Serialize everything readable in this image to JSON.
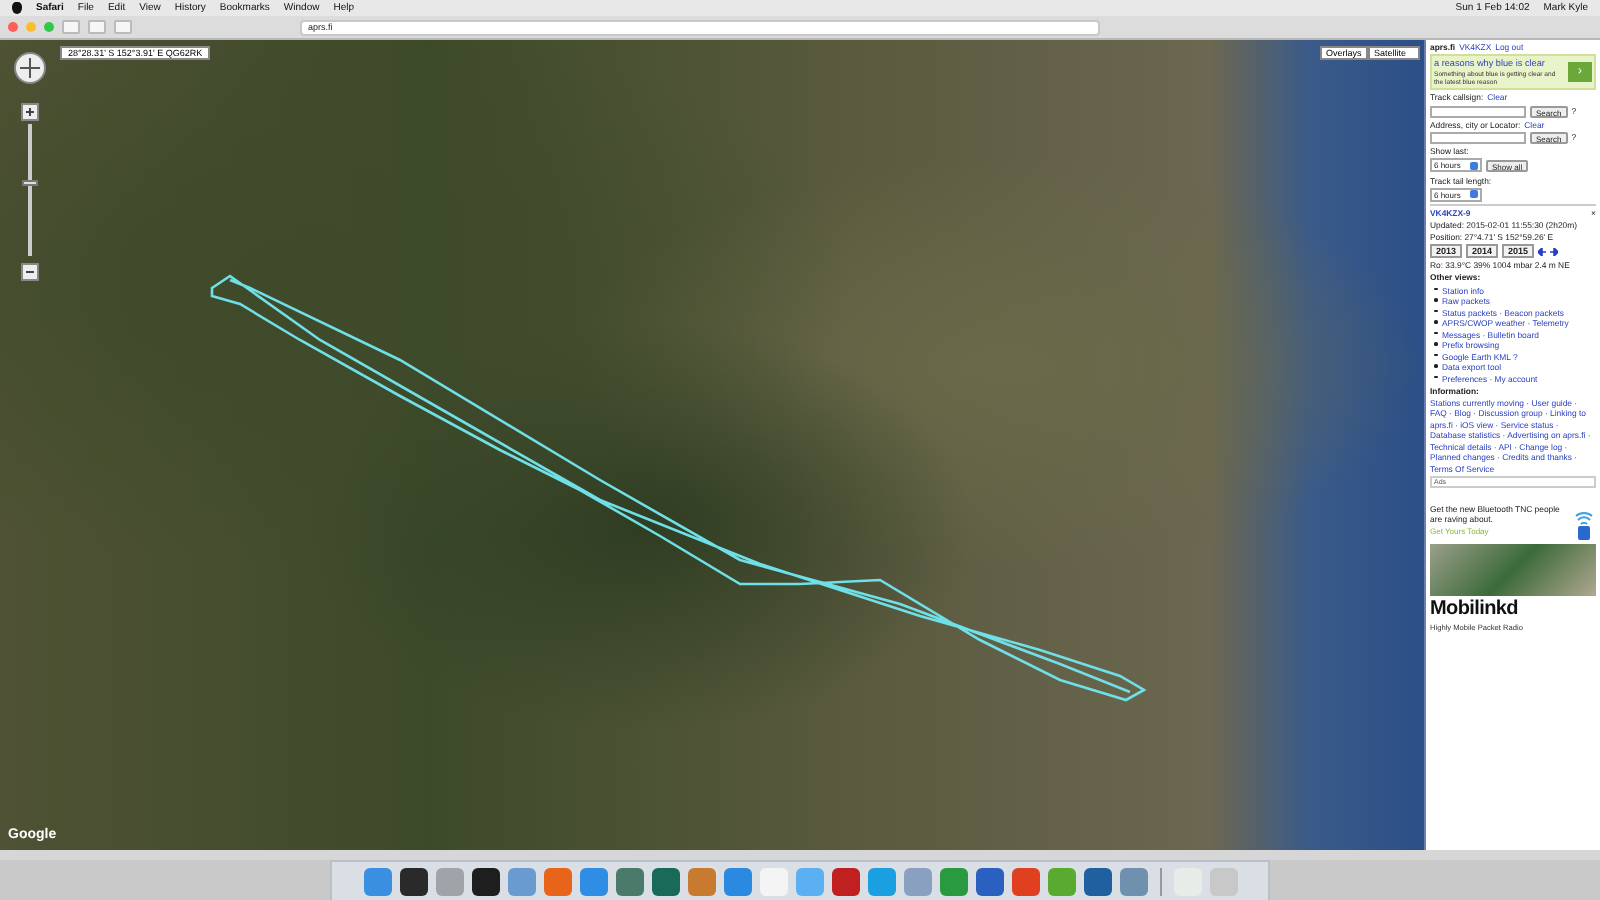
{
  "menu_bar": {
    "items": [
      "Safari",
      "File",
      "Edit",
      "View",
      "History",
      "Bookmarks",
      "Window",
      "Help"
    ],
    "clock": "Sun 1 Feb 14:02",
    "user": "Mark Kyle"
  },
  "toolbar": {
    "address": "aprs.fi"
  },
  "map": {
    "coordinates": "28°28.31' S 152°3.91' E QG62RK",
    "overlay_button": "Overlays",
    "map_type": "Satellite",
    "zoom_slider": {
      "level": 0.55
    },
    "logo": "Google"
  },
  "sidebar": {
    "header": {
      "site": "aprs.fi",
      "callsign": "VK4KZX",
      "logout": "Log out"
    },
    "top_ad": {
      "headline": "a reasons why blue is clear",
      "body": "Something about blue is getting clear and the latest blue reason",
      "button": "›"
    },
    "track_callsign": {
      "label": "Track callsign:",
      "clear": "Clear",
      "button": "Search",
      "help": "?"
    },
    "address_search": {
      "label": "Address, city or Locator:",
      "clear": "Clear",
      "button": "Search",
      "help": "?"
    },
    "show_last": {
      "label": "Show last:",
      "value": "6 hours",
      "button": "Show all"
    },
    "track_tail": {
      "label": "Track tail length:",
      "value": "6 hours"
    },
    "station": {
      "callsign": "VK4KZX-9",
      "close": "×",
      "updated": "Updated: 2015-02-01 11:55:30 (2h20m)",
      "position": "Position: 27°4.71' S 152°59.26' E"
    },
    "years": [
      "2013",
      "2014",
      "2015"
    ],
    "weather": "Ro: 33.9°C 39% 1004 mbar 2.4 m NE",
    "other_views": {
      "title": "Other views:",
      "links": [
        "Station info",
        "Raw packets",
        "Status packets · Beacon packets",
        "APRS/CWOP weather · Telemetry",
        "Messages · Bulletin board",
        "Prefix browsing",
        "Google Earth KML ?",
        "Data export tool",
        "Preferences · My account"
      ]
    },
    "information": {
      "title": "Information:",
      "text": "Stations currently moving · User guide · FAQ · Blog · Discussion group · Linking to aprs.fi · iOS view · Service status · Database statistics · Advertising on aprs.fi · Technical details · API · Change log · Planned changes · Credits and thanks · Terms Of Service"
    },
    "ads_label": "Ads",
    "bottom_ad": {
      "headline": "Get the new Bluetooth TNC people are raving about.",
      "cta": "Get Yours Today",
      "brand": "Mobilinkd",
      "tagline": "Highly Mobile Packet Radio"
    }
  },
  "dock": {
    "apps": [
      {
        "color": "#3b8fe0"
      },
      {
        "color": "#2a2a2a"
      },
      {
        "color": "#a0a4a8"
      },
      {
        "color": "#1e1e1e"
      },
      {
        "color": "#6a9bd0"
      },
      {
        "color": "#e8641a"
      },
      {
        "color": "#2f8de4"
      },
      {
        "color": "#4a7a6a"
      },
      {
        "color": "#1a6a5a"
      },
      {
        "color": "#c87a30"
      },
      {
        "color": "#2a8ae0"
      },
      {
        "color": "#f4f4f4"
      },
      {
        "color": "#5ab0f0"
      },
      {
        "color": "#c02020"
      },
      {
        "color": "#1aa0e0"
      },
      {
        "color": "#8aa0c0"
      },
      {
        "color": "#2a9a40"
      },
      {
        "color": "#2a60c0"
      },
      {
        "color": "#e04020"
      },
      {
        "color": "#5aaa30"
      },
      {
        "color": "#2060a0"
      },
      {
        "color": "#7090b0"
      },
      {
        "color": "#e8ece8"
      },
      {
        "color": "#c8c8c8"
      }
    ]
  }
}
